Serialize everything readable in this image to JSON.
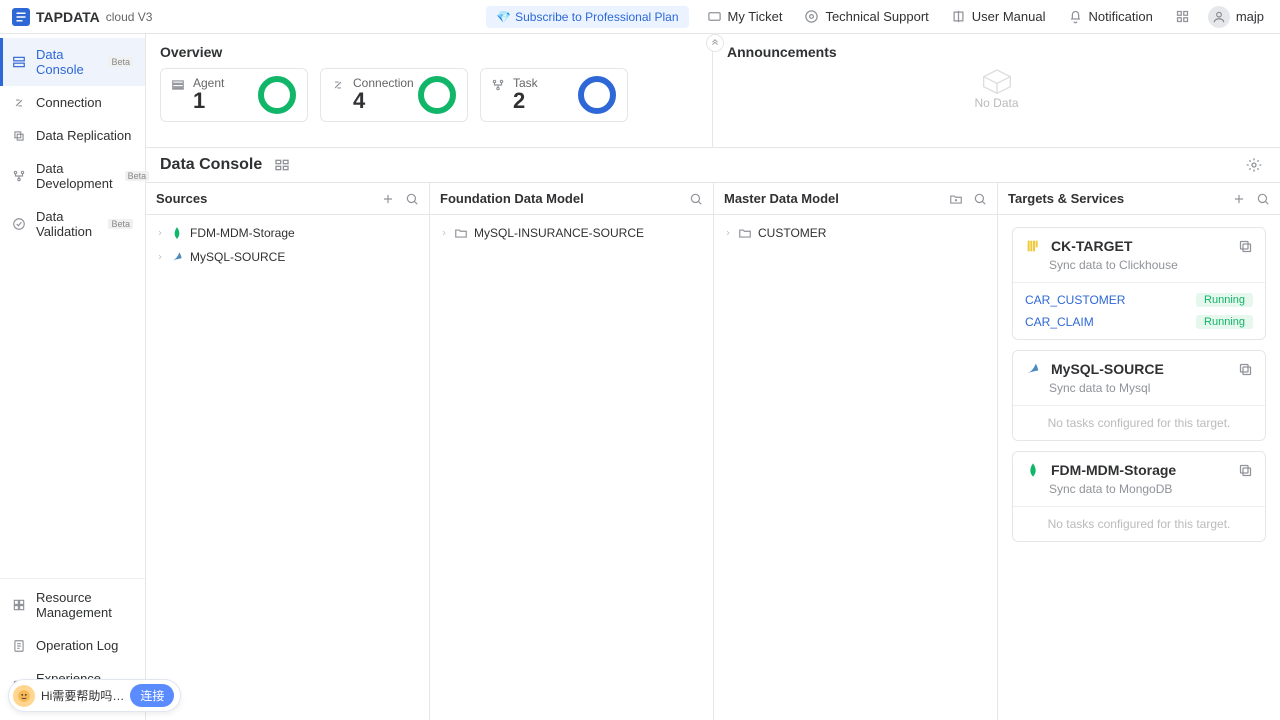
{
  "header": {
    "product_name": "TAPDATA",
    "product_variant": "cloud V3",
    "subscribe_label": "Subscribe to Professional Plan",
    "my_ticket": "My Ticket",
    "technical_support": "Technical Support",
    "user_manual": "User Manual",
    "notification": "Notification",
    "username": "majp"
  },
  "sidebar": {
    "top": [
      {
        "name": "data-console",
        "label": "Data Console",
        "beta": "Beta",
        "active": true
      },
      {
        "name": "connection",
        "label": "Connection"
      },
      {
        "name": "data-replication",
        "label": "Data Replication"
      },
      {
        "name": "data-development",
        "label": "Data Development",
        "beta": "Beta"
      },
      {
        "name": "data-validation",
        "label": "Data Validation",
        "beta": "Beta"
      }
    ],
    "bottom": [
      {
        "name": "resource-management",
        "label": "Resource Management"
      },
      {
        "name": "operation-log",
        "label": "Operation Log"
      },
      {
        "name": "experience-demo",
        "label": "Experience Demo"
      }
    ]
  },
  "overview": {
    "title": "Overview",
    "cards": [
      {
        "name": "agent",
        "label": "Agent",
        "value": "1",
        "color": "#11b669"
      },
      {
        "name": "connection",
        "label": "Connection",
        "value": "4",
        "color": "#11b669"
      },
      {
        "name": "task",
        "label": "Task",
        "value": "2",
        "color": "#2e68d6"
      }
    ]
  },
  "announcements": {
    "title": "Announcements",
    "empty_text": "No Data"
  },
  "data_console": {
    "title": "Data Console"
  },
  "columns": {
    "sources": {
      "title": "Sources",
      "items": [
        {
          "label": "FDM-MDM-Storage",
          "type": "mongo"
        },
        {
          "label": "MySQL-SOURCE",
          "type": "mysql"
        }
      ]
    },
    "foundation": {
      "title": "Foundation Data Model",
      "items": [
        {
          "label": "MySQL-INSURANCE-SOURCE",
          "type": "folder"
        }
      ]
    },
    "master": {
      "title": "Master Data Model",
      "items": [
        {
          "label": "CUSTOMER",
          "type": "folder"
        }
      ]
    },
    "targets": {
      "title": "Targets & Services",
      "cards": [
        {
          "icon": "clickhouse",
          "title": "CK-TARGET",
          "subtitle": "Sync data to Clickhouse",
          "tasks": [
            {
              "name": "CAR_CUSTOMER",
              "status": "Running"
            },
            {
              "name": "CAR_CLAIM",
              "status": "Running"
            }
          ]
        },
        {
          "icon": "mysql",
          "title": "MySQL-SOURCE",
          "subtitle": "Sync data to Mysql",
          "empty": "No tasks configured for this target."
        },
        {
          "icon": "mongo",
          "title": "FDM-MDM-Storage",
          "subtitle": "Sync data to MongoDB",
          "empty": "No tasks configured for this target."
        }
      ]
    }
  },
  "help": {
    "text": "Hi需要帮助吗…",
    "button": "连接"
  },
  "status_running": "Running"
}
